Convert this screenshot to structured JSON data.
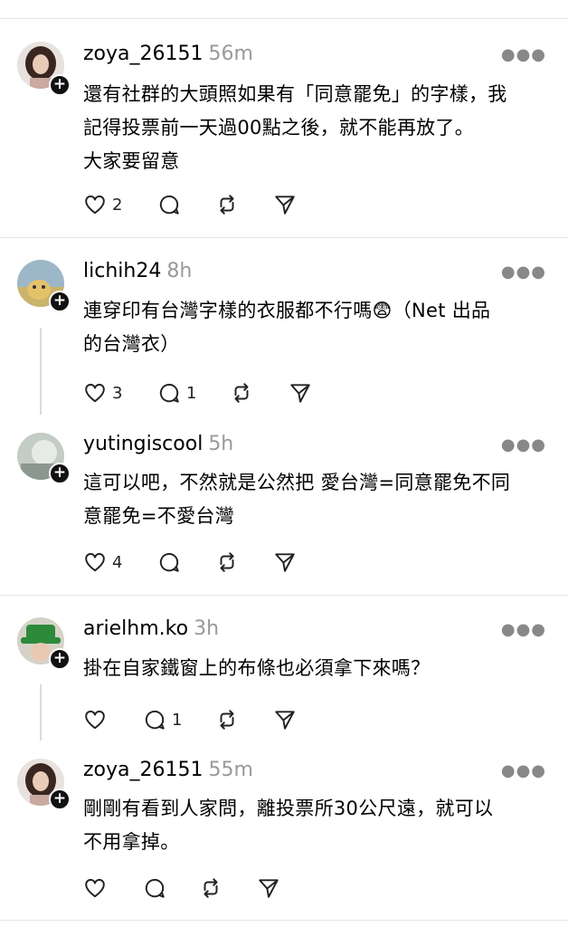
{
  "posts": [
    {
      "username": "zoya_26151",
      "time": "56m",
      "text": "還有社群的大頭照如果有「同意罷免」的字樣，我\n記得投票前一天過00點之後，就不能再放了。\n大家要留意",
      "likes": "2",
      "replies": "",
      "avatar": "avatar-woman-curly-hair"
    },
    {
      "username": "lichih24",
      "time": "8h",
      "text": "連穿印有台灣字樣的衣服都不行嗎😨（Net 出品\n的台灣衣）",
      "likes": "3",
      "replies": "1",
      "avatar": "avatar-cat-photo"
    },
    {
      "username": "yutingiscool",
      "time": "5h",
      "text": "這可以吧，不然就是公然把 愛台灣=同意罷免不同\n意罷免=不愛台灣",
      "likes": "4",
      "replies": "",
      "avatar": "avatar-blurry-photo"
    },
    {
      "username": "arielhm.ko",
      "time": "3h",
      "text": "掛在自家鐵窗上的布條也必須拿下來嗎？",
      "likes": "",
      "replies": "1",
      "avatar": "avatar-green-hat"
    },
    {
      "username": "zoya_26151",
      "time": "55m",
      "text": "剛剛有看到人家問，離投票所30公尺遠，就可以\n不用拿掉。",
      "likes": "",
      "replies": "",
      "avatar": "avatar-woman-curly-hair"
    }
  ],
  "icons": {
    "more": "more-options-icon",
    "like": "heart-icon",
    "reply": "comment-icon",
    "repost": "repost-icon",
    "share": "send-icon"
  }
}
